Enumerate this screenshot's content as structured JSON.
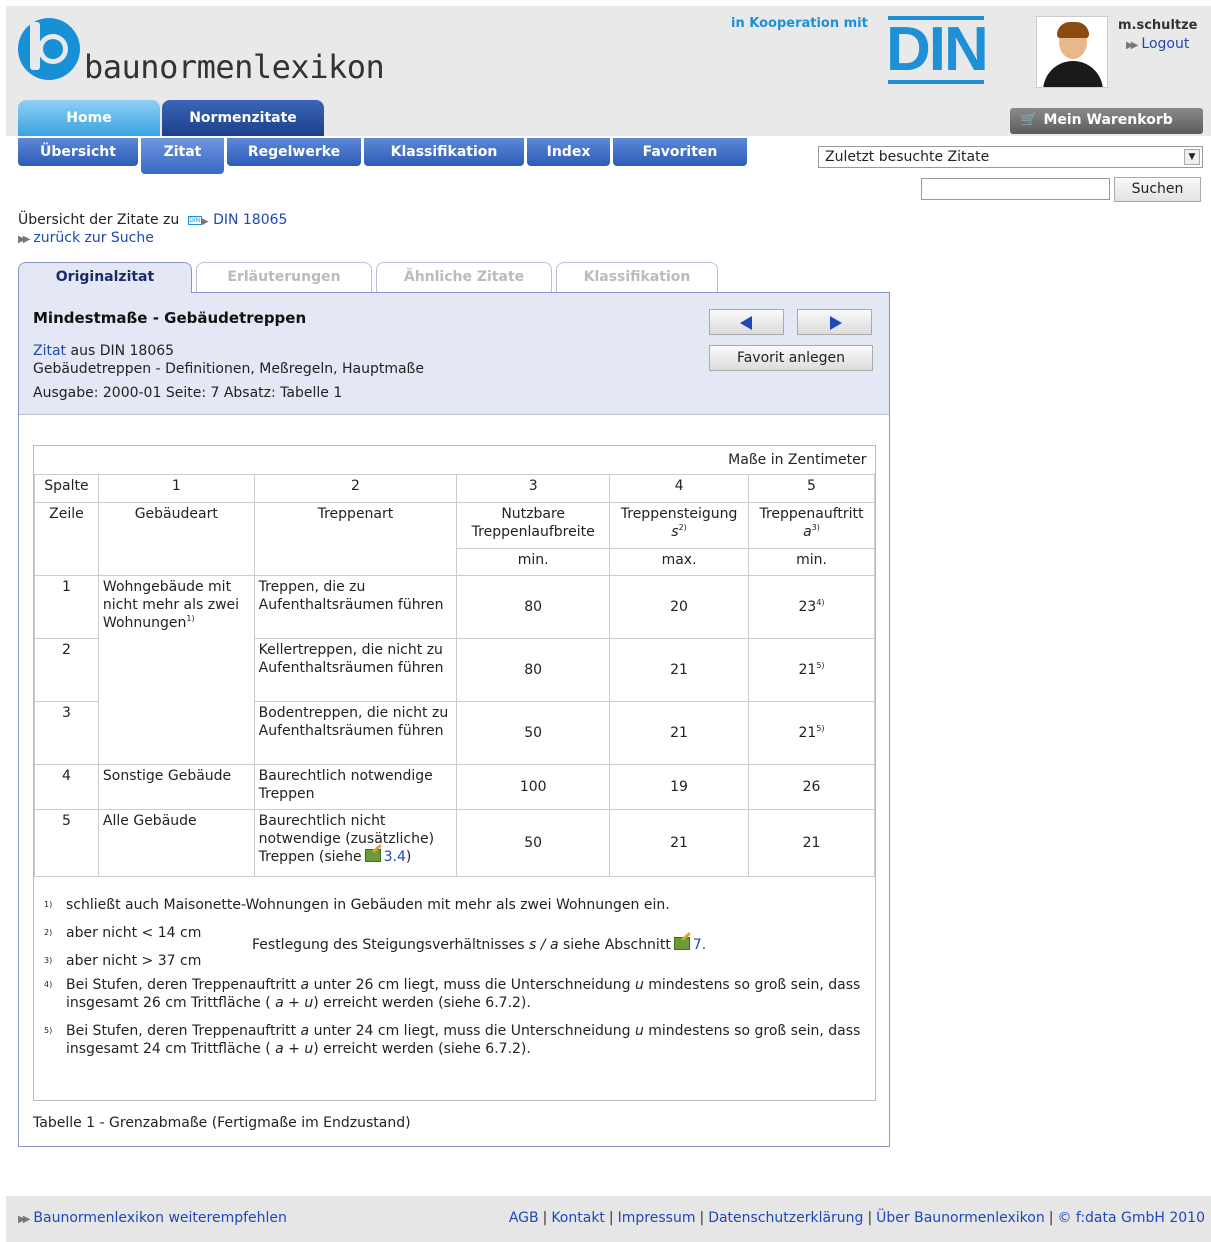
{
  "header": {
    "logo_text": "baunormenlexikon",
    "cooperation": "in Kooperation mit",
    "partner_logo": "DIN",
    "username": "m.schultze",
    "logout": "Logout",
    "cart": "Mein Warenkorb",
    "accent_color": "#1890d6"
  },
  "tabs_main": [
    {
      "label": "Home"
    },
    {
      "label": "Normenzitate"
    }
  ],
  "tabs_sub": [
    {
      "label": "Übersicht"
    },
    {
      "label": "Zitat"
    },
    {
      "label": "Regelwerke"
    },
    {
      "label": "Klassifikation"
    },
    {
      "label": "Index"
    },
    {
      "label": "Favoriten"
    }
  ],
  "search": {
    "recent_select": "Zuletzt besuchte Zitate",
    "input_value": "",
    "button": "Suchen"
  },
  "breadcrumb": {
    "prefix": "Übersicht der Zitate zu",
    "din_icon": "DIN",
    "norm_link": "DIN 18065",
    "back": "zurück zur Suche"
  },
  "content_tabs": [
    {
      "label": "Originalzitat"
    },
    {
      "label": "Erläuterungen"
    },
    {
      "label": "Ähnliche Zitate"
    },
    {
      "label": "Klassifikation"
    }
  ],
  "citation": {
    "title": "Mindestmaße - Gebäudetreppen",
    "zitat_link": "Zitat",
    "source": "aus DIN 18065",
    "subtitle": "Gebäudetreppen - Definitionen, Meßregeln, Hauptmaße",
    "ausgabe": "Ausgabe: 2000-01 Seite: 7 Absatz: Tabelle 1",
    "favorite_button": "Favorit anlegen"
  },
  "table": {
    "unit_note": "Maße in Zentimeter",
    "col_numbers": [
      "Spalte",
      "1",
      "2",
      "3",
      "4",
      "5"
    ],
    "head": {
      "zeile": "Zeile",
      "gebaeudeart": "Gebäudeart",
      "treppenart": "Treppenart",
      "laufbreite": "Nutzbare Treppenlaufbreite",
      "steigung": "Treppensteigung",
      "steigung_sym": "s",
      "steigung_sup": "2)",
      "auftritt": "Treppenauftritt",
      "auftritt_sym": "a",
      "auftritt_sup": "3)",
      "min1": "min.",
      "max": "max.",
      "min2": "min."
    },
    "rows": [
      {
        "zeile": "1",
        "gebaeude": "Wohngebäude mit nicht mehr als zwei Wohnungen",
        "gebaeude_sup": "1)",
        "treppe": "Treppen, die zu Aufenthaltsräumen führen",
        "breite": "80",
        "steigung": "20",
        "auftritt": "23",
        "auftritt_sup": "4)"
      },
      {
        "zeile": "2",
        "treppe": "Kellertreppen, die nicht zu Aufenthaltsräumen führen",
        "breite": "80",
        "steigung": "21",
        "auftritt": "21",
        "auftritt_sup": "5)"
      },
      {
        "zeile": "3",
        "treppe": "Bodentreppen, die nicht zu Aufenthaltsräumen führen",
        "breite": "50",
        "steigung": "21",
        "auftritt": "21",
        "auftritt_sup": "5)"
      },
      {
        "zeile": "4",
        "gebaeude": "Sonstige Gebäude",
        "treppe": "Baurechtlich notwendige Treppen",
        "breite": "100",
        "steigung": "19",
        "auftritt": "26"
      },
      {
        "zeile": "5",
        "gebaeude": "Alle Gebäude",
        "treppe": "Baurechtlich nicht notwendige (zusätzliche) Treppen (siehe",
        "treppe_link": "3.4",
        "treppe_end": ")",
        "breite": "50",
        "steigung": "21",
        "auftritt": "21"
      }
    ],
    "footnotes": {
      "fn1_num": "1)",
      "fn1": "schließt auch Maisonette-Wohnungen in Gebäuden mit mehr als zwei Wohnungen ein.",
      "fn2_num": "2)",
      "fn2": "aber nicht < 14 cm",
      "fn3_num": "3)",
      "fn3": "aber nicht > 37 cm",
      "fn23_shared_a": "Festlegung des Steigungsverhältnisses",
      "fn23_shared_sym": "s / a",
      "fn23_shared_b": "siehe Abschnitt",
      "fn23_link": "7.",
      "fn4_num": "4)",
      "fn4_a": "Bei Stufen, deren Treppenauftritt",
      "fn4_b": "unter 26 cm liegt, muss die Unterschneidung",
      "fn4_c": "mindestens so groß sein, dass insgesamt 26 cm Trittfläche (",
      "fn4_d": ") erreicht werden (siehe 6.7.2).",
      "fn5_num": "5)",
      "fn5_a": "Bei Stufen, deren Treppenauftritt",
      "fn5_b": "unter 24 cm liegt, muss die Unterschneidung",
      "fn5_c": "mindestens so groß sein, dass insgesamt 24 cm Trittfläche (",
      "fn5_d": ") erreicht werden (siehe 6.7.2).",
      "sym_a": "a",
      "sym_u": "u",
      "sym_au": "a + u"
    },
    "caption": "Tabelle 1 - Grenzabmaße (Fertigmaße im Endzustand)"
  },
  "footer": {
    "recommend": "Baunormenlexikon weiterempfehlen",
    "links": [
      "AGB",
      "Kontakt",
      "Impressum",
      "Datenschutzerklärung",
      "Über Baunormenlexikon",
      "© f:data GmbH 2010"
    ],
    "sep": "|"
  }
}
